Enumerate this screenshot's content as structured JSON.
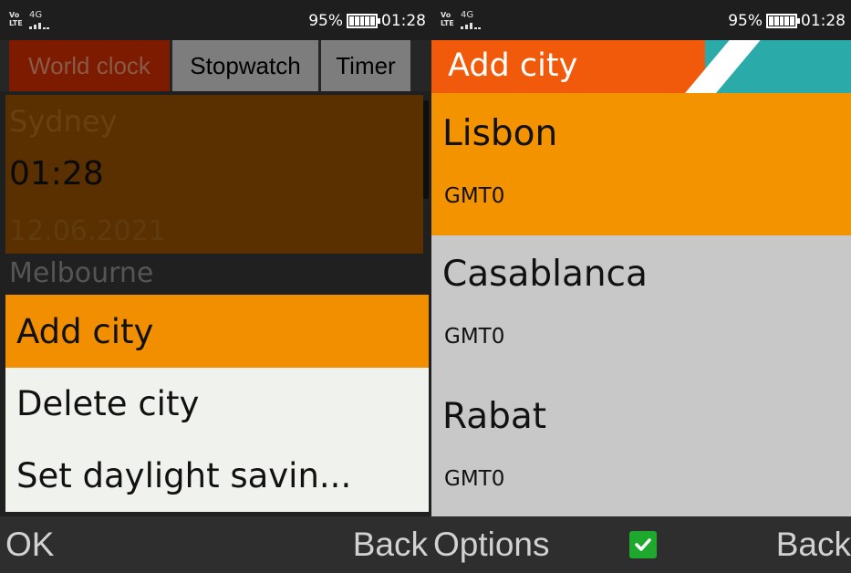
{
  "left_screen": {
    "status": {
      "signal_icon": "signal-icon",
      "battery_percent": "95%",
      "time": "01:28"
    },
    "tabs": [
      {
        "label": "World clock",
        "active": true
      },
      {
        "label": "Stopwatch",
        "active": false
      },
      {
        "label": "Timer",
        "active": false
      }
    ],
    "clocks": [
      {
        "city": "Sydney",
        "time": "01:28",
        "date": "12.06.2021"
      },
      {
        "city": "Melbourne"
      }
    ],
    "menu": [
      {
        "label": "Add city",
        "selected": true
      },
      {
        "label": "Delete city",
        "selected": false
      },
      {
        "label": "Set daylight savin...",
        "selected": false
      }
    ],
    "softkeys": {
      "left": "OK",
      "right": "Back"
    }
  },
  "right_screen": {
    "status": {
      "signal_icon": "signal-icon",
      "battery_percent": "95%",
      "time": "01:28"
    },
    "title": "Add city",
    "cities": [
      {
        "name": "Lisbon",
        "tz": "GMT0",
        "selected": true
      },
      {
        "name": "Casablanca",
        "tz": "GMT0",
        "selected": false
      },
      {
        "name": "Rabat",
        "tz": "GMT0",
        "selected": false
      }
    ],
    "softkeys": {
      "left": "Options",
      "center_icon": "check-icon",
      "right": "Back"
    }
  },
  "colors": {
    "accent_orange": "#f39300",
    "header_orange": "#f05a0a",
    "header_teal": "#2aaaa8",
    "check_green": "#1fa82e"
  }
}
